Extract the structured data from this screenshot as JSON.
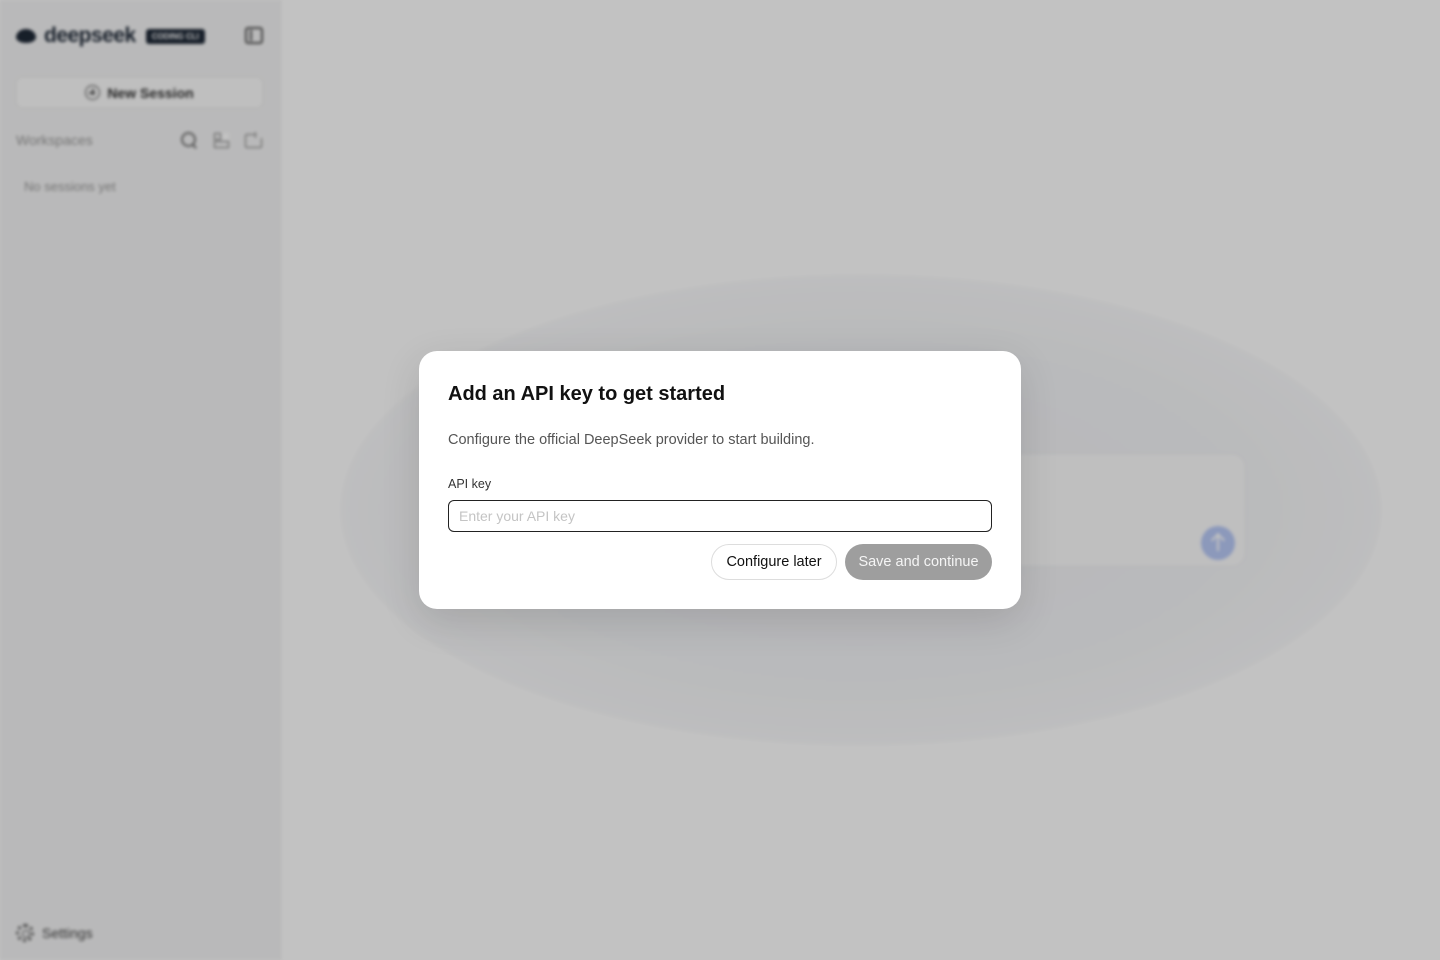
{
  "sidebar": {
    "brand_name": "deepseek",
    "brand_badge": "CODING CLI",
    "new_session_label": "New Session",
    "workspaces_label": "Workspaces",
    "empty_sessions": "No sessions yet",
    "settings_label": "Settings"
  },
  "modal": {
    "title": "Add an API key to get started",
    "description": "Configure the official DeepSeek provider to start building.",
    "field_label": "API key",
    "input_value": "",
    "input_placeholder": "Enter your API key",
    "secondary_button": "Configure later",
    "primary_button": "Save and continue"
  },
  "colors": {
    "primary_disabled": "#9e9e9e",
    "send_button": "#b8c9f6",
    "overlay": "rgba(0,0,0,0.24)"
  }
}
